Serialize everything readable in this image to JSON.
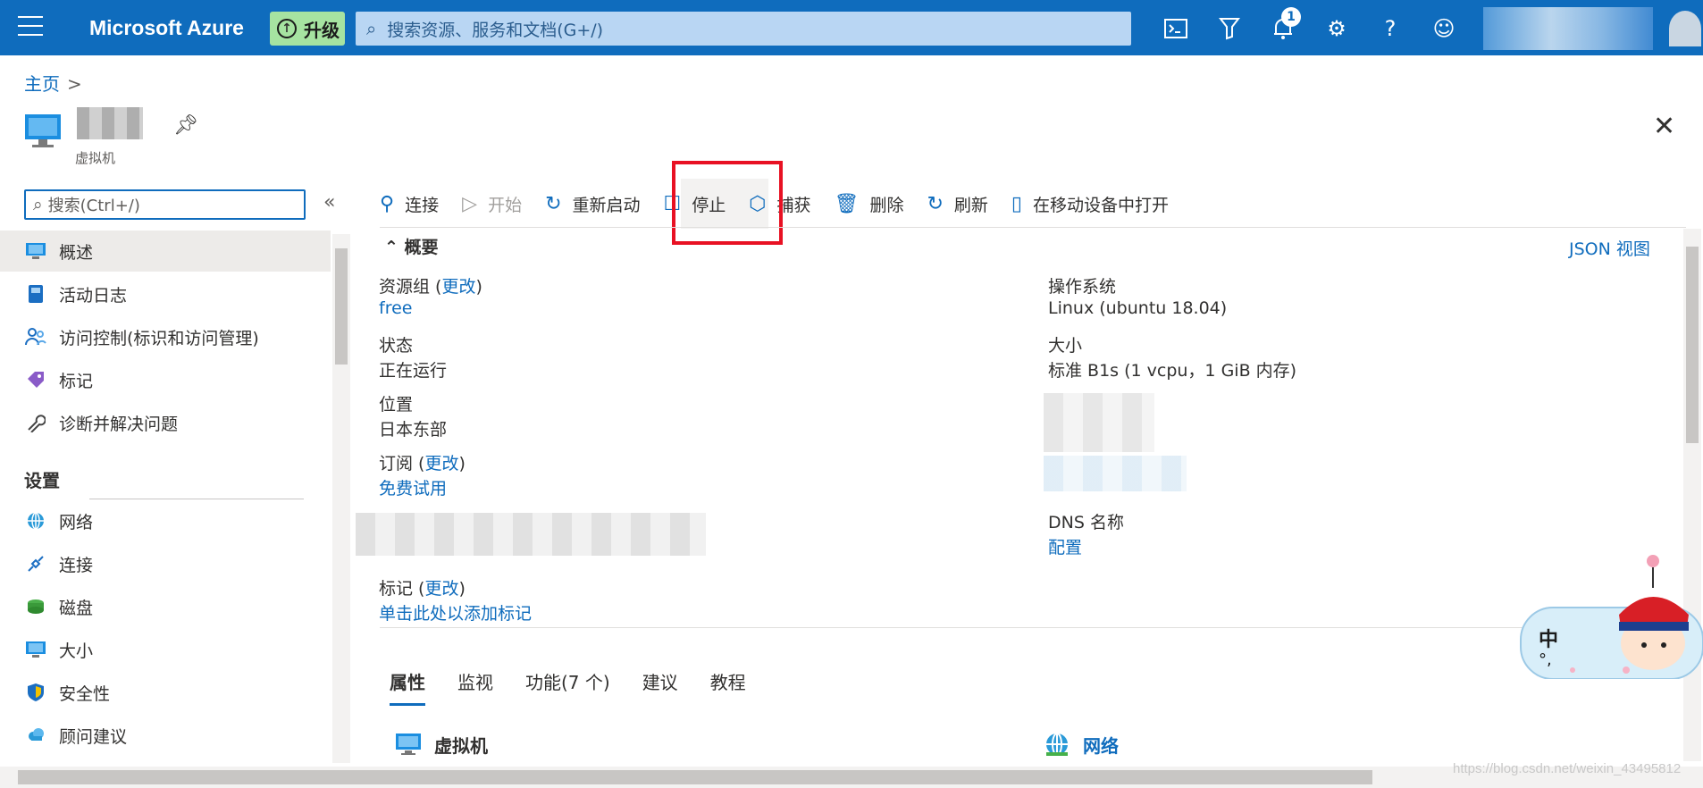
{
  "topbar": {
    "brand": "Microsoft Azure",
    "upgrade_label": "升级",
    "search_placeholder": "搜索资源、服务和文档(G+/)",
    "notification_count": "1",
    "accent_color": "#0f6cbd",
    "icons": [
      "menu-icon",
      "cloud-shell-icon",
      "directory-filter-icon",
      "bell-icon",
      "gear-icon",
      "help-icon",
      "feedback-smiley-icon"
    ]
  },
  "breadcrumb": {
    "home": "主页",
    "separator": ">"
  },
  "resource": {
    "type_label": "虚拟机"
  },
  "sidebar": {
    "search_placeholder": "搜索(Ctrl+/)",
    "collapse": "«",
    "items": [
      {
        "label": "概述",
        "icon": "monitor-icon"
      },
      {
        "label": "活动日志",
        "icon": "log-book-icon"
      },
      {
        "label": "访问控制(标识和访问管理)",
        "icon": "people-icon"
      },
      {
        "label": "标记",
        "icon": "tag-icon"
      },
      {
        "label": "诊断并解决问题",
        "icon": "wrench-icon"
      }
    ],
    "section_settings": "设置",
    "settings_items": [
      {
        "label": "网络",
        "icon": "network-globe-icon"
      },
      {
        "label": "连接",
        "icon": "plug-icon"
      },
      {
        "label": "磁盘",
        "icon": "disk-icon"
      },
      {
        "label": "大小",
        "icon": "monitor-icon"
      },
      {
        "label": "安全性",
        "icon": "shield-icon"
      },
      {
        "label": "顾问建议",
        "icon": "advisor-cloud-icon"
      }
    ]
  },
  "toolbar": {
    "connect": "连接",
    "start": "开始",
    "restart": "重新启动",
    "stop": "停止",
    "capture": "捕获",
    "delete": "删除",
    "refresh": "刷新",
    "open_mobile": "在移动设备中打开"
  },
  "essentials": {
    "header": "概要",
    "json_view": "JSON 视图",
    "resource_group_label": "资源组",
    "change": "更改",
    "resource_group_value": "free",
    "status_label": "状态",
    "status_value": "正在运行",
    "location_label": "位置",
    "location_value": "日本东部",
    "subscription_label": "订阅",
    "subscription_value": "免费试用",
    "tags_label": "标记",
    "tags_value": "单击此处以添加标记",
    "os_label": "操作系统",
    "os_value": "Linux (ubuntu 18.04)",
    "size_label": "大小",
    "size_value": "标准 B1s (1 vcpu，1 GiB 内存)",
    "dns_label": "DNS 名称",
    "dns_value": "配置"
  },
  "tabs": [
    "属性",
    "监视",
    "功能(7 个)",
    "建议",
    "教程"
  ],
  "properties": {
    "vm_title": "虚拟机",
    "network_title": "网络"
  },
  "mascot": {
    "char1": "中",
    "char2": "°,"
  },
  "watermark": "https://blog.csdn.net/weixin_43495812"
}
